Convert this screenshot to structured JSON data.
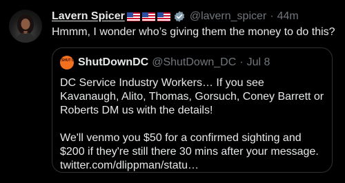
{
  "tweet": {
    "author_name": "Lavern Spicer",
    "handle": "@lavern_spicer",
    "separator": "·",
    "time": "44m",
    "text": "Hmmm, I wonder who’s giving them the money to do this?",
    "more_label": "···",
    "flag_count": 3
  },
  "quoted_tweet": {
    "author_name": "ShutDownDC",
    "handle": "@ShutDown_DC",
    "separator": "·",
    "date": "Jul 8",
    "avatar_text": "SHUT DOWN DC",
    "paragraph_1": "DC Service Industry Workers… If you see Kavanaugh, Alito, Thomas, Gorsuch, Coney Barrett or Roberts DM us with the details!",
    "paragraph_2": "We'll venmo you $50 for a confirmed sighting and $200 if they're still there 30 mins after your message. twitter.com/dlippman/statu…"
  },
  "icons": {
    "verified": "verified-badge-icon",
    "flag": "us-flag-icon"
  },
  "colors": {
    "background": "#000000",
    "text": "#e7e9ea",
    "muted": "#71767b",
    "border": "#2f3336",
    "brand_orange": "#f2701e"
  }
}
